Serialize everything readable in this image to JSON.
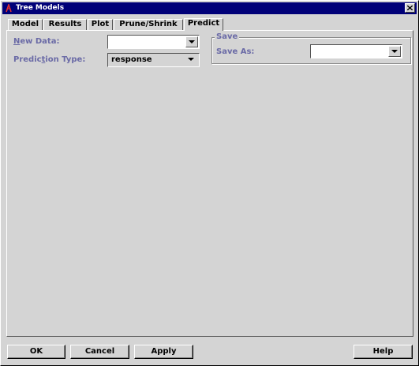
{
  "window": {
    "title": "Tree Models"
  },
  "tabs": [
    {
      "label": "Model"
    },
    {
      "label": "Results"
    },
    {
      "label": "Plot"
    },
    {
      "label": "Prune/Shrink"
    },
    {
      "label": "Predict",
      "active": true
    }
  ],
  "form": {
    "new_data": {
      "label_u": "N",
      "label_rest": "ew Data:",
      "value": ""
    },
    "prediction_type": {
      "label_a": "Predic",
      "label_u": "t",
      "label_b": "ion Type:",
      "value": "response"
    }
  },
  "save_group": {
    "legend": "Save",
    "save_as": {
      "label": "Save As:",
      "value": ""
    }
  },
  "buttons": {
    "ok": "OK",
    "cancel": "Cancel",
    "apply": "Apply",
    "help": "Help"
  },
  "icons": {
    "app": "tree-app-icon",
    "close": "close-icon",
    "dropdown": "chevron-down-icon"
  }
}
